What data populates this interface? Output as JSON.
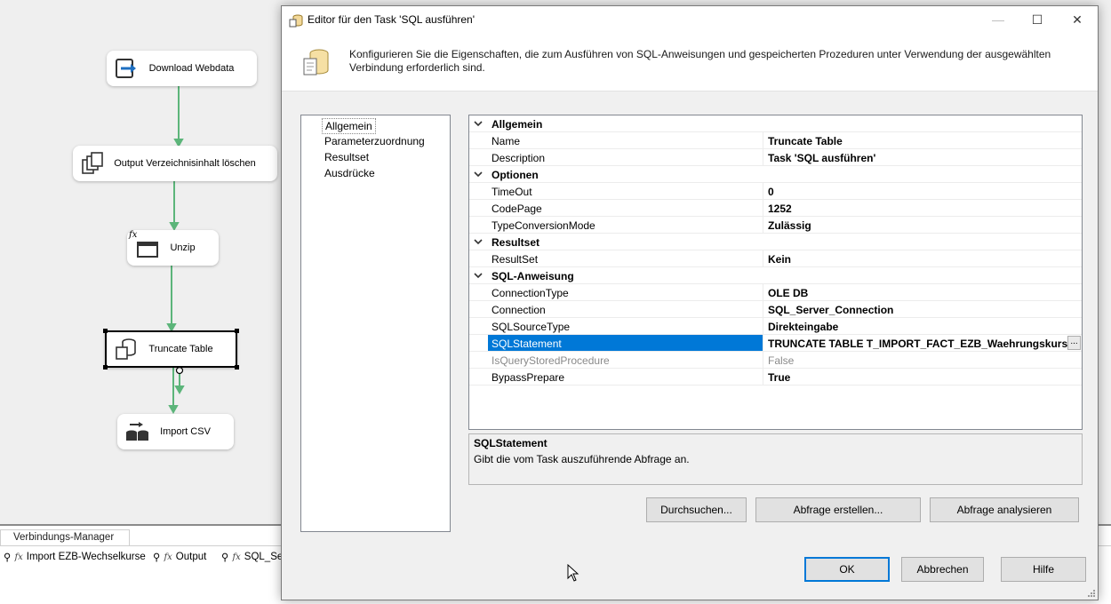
{
  "designer": {
    "tasks": [
      {
        "label": "Download Webdata",
        "icon": "download-icon"
      },
      {
        "label": "Output Verzeichnisinhalt löschen",
        "icon": "file-system-icon"
      },
      {
        "label": "Unzip",
        "icon": "execute-process-icon"
      },
      {
        "label": "Truncate Table",
        "icon": "sql-task-icon"
      },
      {
        "label": "Import CSV",
        "icon": "data-flow-icon"
      }
    ],
    "fx_badge": "fx"
  },
  "connection_manager": {
    "tab_label": "Verbindungs-Manager",
    "fx_badge": "fx",
    "items": [
      {
        "label": "Import EZB-Wechselkurse"
      },
      {
        "label": "Output"
      },
      {
        "label": "SQL_Ser"
      }
    ]
  },
  "dialog": {
    "title": "Editor für den Task 'SQL ausführen'",
    "window_buttons": {
      "minimize": "—",
      "maximize": "☐",
      "close": "✕"
    },
    "header_text": "Konfigurieren Sie die Eigenschaften, die zum Ausführen von SQL-Anweisungen und gespeicherten Prozeduren unter Verwendung der ausgewählten Verbindung erforderlich sind.",
    "nav": [
      {
        "label": "Allgemein",
        "selected": true
      },
      {
        "label": "Parameterzuordnung",
        "selected": false
      },
      {
        "label": "Resultset",
        "selected": false
      },
      {
        "label": "Ausdrücke",
        "selected": false
      }
    ],
    "grid": {
      "categories": [
        {
          "name": "Allgemein",
          "props": [
            {
              "name": "Name",
              "value": "Truncate Table"
            },
            {
              "name": "Description",
              "value": "Task 'SQL ausführen'"
            }
          ]
        },
        {
          "name": "Optionen",
          "props": [
            {
              "name": "TimeOut",
              "value": "0"
            },
            {
              "name": "CodePage",
              "value": "1252"
            },
            {
              "name": "TypeConversionMode",
              "value": "Zulässig"
            }
          ]
        },
        {
          "name": "Resultset",
          "props": [
            {
              "name": "ResultSet",
              "value": "Kein"
            }
          ]
        },
        {
          "name": "SQL-Anweisung",
          "props": [
            {
              "name": "ConnectionType",
              "value": "OLE DB"
            },
            {
              "name": "Connection",
              "value": "SQL_Server_Connection"
            },
            {
              "name": "SQLSourceType",
              "value": "Direkteingabe"
            },
            {
              "name": "SQLStatement",
              "value": "TRUNCATE TABLE T_IMPORT_FACT_EZB_Waehrungskurse",
              "selected": true,
              "ellipsis": "..."
            },
            {
              "name": "IsQueryStoredProcedure",
              "value": "False",
              "disabled": true
            },
            {
              "name": "BypassPrepare",
              "value": "True"
            }
          ]
        }
      ]
    },
    "description": {
      "title": "SQLStatement",
      "text": "Gibt die vom Task auszuführende Abfrage an."
    },
    "buttons": {
      "browse": "Durchsuchen...",
      "build_query": "Abfrage erstellen...",
      "parse_query": "Abfrage analysieren",
      "ok": "OK",
      "cancel": "Abbrechen",
      "help": "Hilfe"
    }
  },
  "colors": {
    "accent": "#0078d7",
    "connector": "#5cb57a",
    "background": "#efefef"
  }
}
